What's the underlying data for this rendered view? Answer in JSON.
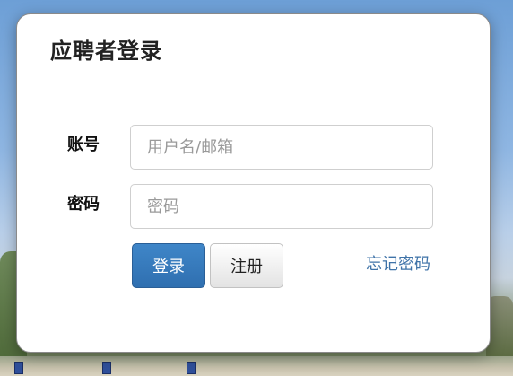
{
  "dialog": {
    "title": "应聘者登录"
  },
  "form": {
    "account": {
      "label": "账号",
      "placeholder": "用户名/邮箱",
      "value": ""
    },
    "password": {
      "label": "密码",
      "placeholder": "密码",
      "value": ""
    }
  },
  "actions": {
    "login_label": "登录",
    "register_label": "注册",
    "forgot_label": "忘记密码"
  },
  "colors": {
    "primary_button": "#337ab7",
    "link": "#3f73a8",
    "title_text": "#222222"
  }
}
